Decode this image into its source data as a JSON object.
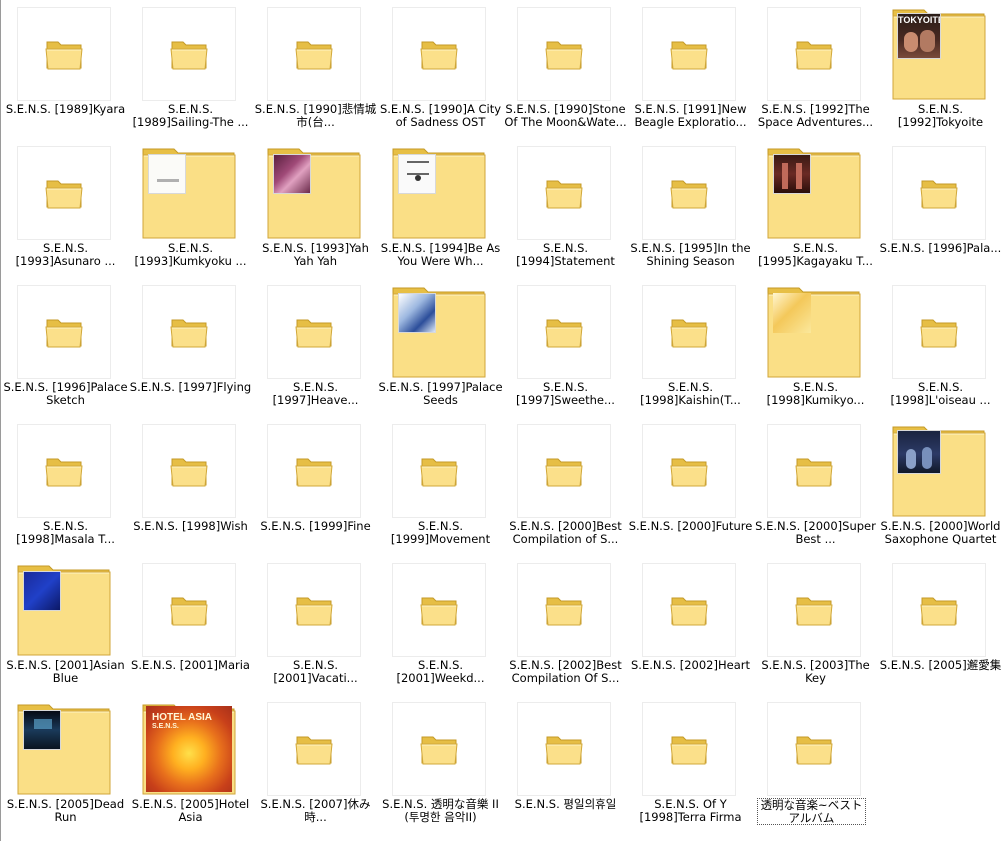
{
  "items": [
    {
      "label": "S.E.N.S. [1989]Kyara",
      "cover": null
    },
    {
      "label": "S.E.N.S. [1989]Sailing-The ...",
      "cover": null
    },
    {
      "label": "S.E.N.S. [1990]悲情城市(台...",
      "cover": null
    },
    {
      "label": "S.E.N.S. [1990]A City of Sadness OST",
      "cover": null
    },
    {
      "label": "S.E.N.S. [1990]Stone Of The Moon&Wate...",
      "cover": null
    },
    {
      "label": "S.E.N.S. [1991]New Beagle Exploratio...",
      "cover": null
    },
    {
      "label": "S.E.N.S. [1992]The Space Adventures...",
      "cover": null
    },
    {
      "label": "S.E.N.S. [1992]Tokyoite",
      "cover": "tokyoite",
      "cover_text": "TOKYOITE"
    },
    {
      "label": "S.E.N.S. [1993]Asunaro ...",
      "cover": null
    },
    {
      "label": "S.E.N.S. [1993]Kumkyoku ...",
      "cover": "kumkyoku"
    },
    {
      "label": "S.E.N.S. [1993]Yah Yah Yah",
      "cover": "yahyah"
    },
    {
      "label": "S.E.N.S. [1994]Be As You Were Wh...",
      "cover": "beasyou"
    },
    {
      "label": "S.E.N.S. [1994]Statement",
      "cover": null
    },
    {
      "label": "S.E.N.S. [1995]In the Shining Season",
      "cover": null
    },
    {
      "label": "S.E.N.S. [1995]Kagayaku T...",
      "cover": "kagayaku"
    },
    {
      "label": "S.E.N.S. [1996]Pala...",
      "cover": null
    },
    {
      "label": "S.E.N.S. [1996]Palace Sketch",
      "cover": null
    },
    {
      "label": "S.E.N.S. [1997]Flying",
      "cover": null
    },
    {
      "label": "S.E.N.S. [1997]Heave...",
      "cover": null
    },
    {
      "label": "S.E.N.S. [1997]Palace Seeds",
      "cover": "palaceseeds"
    },
    {
      "label": "S.E.N.S. [1997]Sweethe...",
      "cover": null
    },
    {
      "label": "S.E.N.S. [1998]Kaishin(T...",
      "cover": null
    },
    {
      "label": "S.E.N.S. [1998]Kumikyo...",
      "cover": "kumikyo"
    },
    {
      "label": "S.E.N.S. [1998]L'oiseau ...",
      "cover": null
    },
    {
      "label": "S.E.N.S. [1998]Masala T...",
      "cover": null
    },
    {
      "label": "S.E.N.S. [1998]Wish",
      "cover": null
    },
    {
      "label": "S.E.N.S. [1999]Fine",
      "cover": null
    },
    {
      "label": "S.E.N.S. [1999]Movement",
      "cover": null
    },
    {
      "label": "S.E.N.S. [2000]Best Compilation of S...",
      "cover": null
    },
    {
      "label": "S.E.N.S. [2000]Future",
      "cover": null
    },
    {
      "label": "S.E.N.S. [2000]Super Best ...",
      "cover": null
    },
    {
      "label": "S.E.N.S. [2000]World Saxophone Quartet",
      "cover": "worldsax"
    },
    {
      "label": "S.E.N.S. [2001]Asian Blue",
      "cover": "asianblue"
    },
    {
      "label": "S.E.N.S. [2001]Maria",
      "cover": null
    },
    {
      "label": "S.E.N.S. [2001]Vacati...",
      "cover": null
    },
    {
      "label": "S.E.N.S. [2001]Weekd...",
      "cover": null
    },
    {
      "label": "S.E.N.S. [2002]Best Compilation Of S...",
      "cover": null
    },
    {
      "label": "S.E.N.S. [2002]Heart",
      "cover": null
    },
    {
      "label": "S.E.N.S. [2003]The Key",
      "cover": null
    },
    {
      "label": "S.E.N.S. [2005]邂愛集",
      "cover": null
    },
    {
      "label": "S.E.N.S. [2005]Dead Run",
      "cover": "deadrun"
    },
    {
      "label": "S.E.N.S. [2005]Hotel Asia",
      "cover": "hotelasia",
      "cover_text": "HOTEL ASIA",
      "cover_subtext": "S.E.N.S."
    },
    {
      "label": "S.E.N.S. [2007]休み時...",
      "cover": null
    },
    {
      "label": "S.E.N.S. 透明な音樂 II (투명한 음악II)",
      "cover": null
    },
    {
      "label": "S.E.N.S. 평일의휴일",
      "cover": null
    },
    {
      "label": "S.E.N.S. Of Y [1998]Terra Firma",
      "cover": null
    },
    {
      "label": "透明な音楽~ベストアルバム",
      "cover": null,
      "selected": true
    }
  ],
  "colors": {
    "folder_back": "#e9c24a",
    "folder_front": "#fbe28a",
    "folder_edge": "#c79a24",
    "selection_border": "#555555"
  }
}
